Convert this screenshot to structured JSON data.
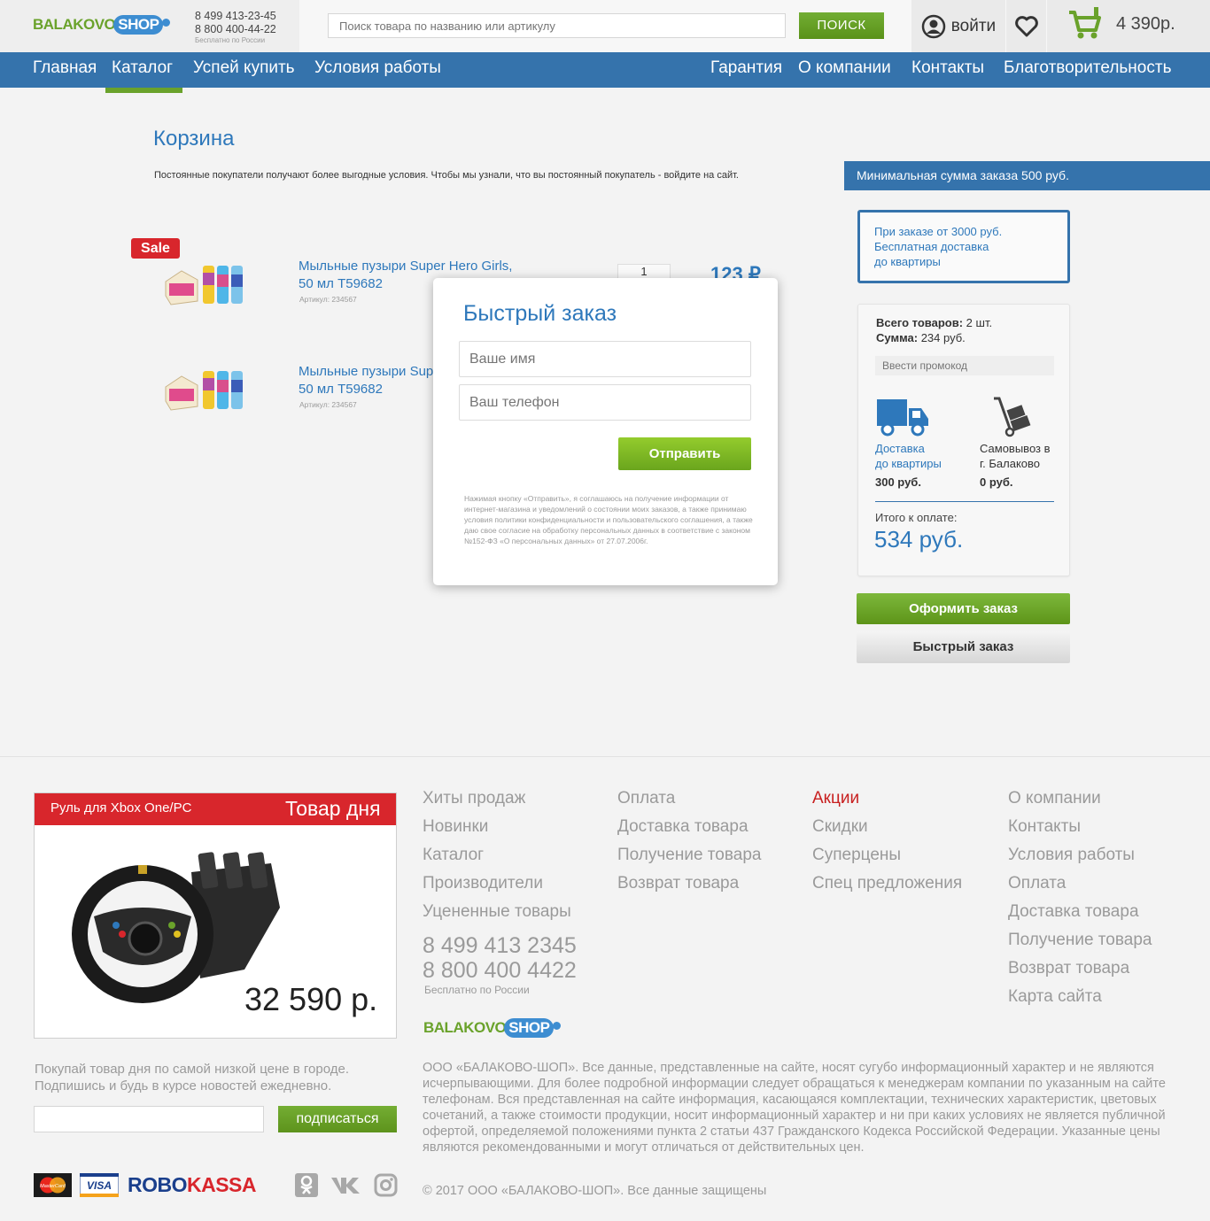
{
  "header": {
    "logo": {
      "part1": "BALAKOVO",
      "part2": "SHOP"
    },
    "phone1": "8 499 413-23-45",
    "phone2": "8 800 400-44-22",
    "phone_note": "Бесплатно по России",
    "search_placeholder": "Поиск товара по названию или артикулу",
    "search_button": "ПОИСК",
    "login": "войти",
    "cart_total": "4 390р."
  },
  "nav": {
    "left": [
      "Главная",
      "Каталог",
      "Успей купить",
      "Условия работы"
    ],
    "right": [
      "Гарантия",
      "О компании",
      "Контакты",
      "Благотворительность"
    ],
    "active": "Каталог"
  },
  "cart": {
    "title": "Корзина",
    "notice": "Постоянные покупатели получают более выгодные условия. Чтобы мы узнали, что вы постоянный покупатель - войдите на сайт.",
    "min_sum": "Минимальная сумма заказа 500 руб.",
    "items": [
      {
        "badge": "Sale",
        "name_l1": "Мыльные пузыри Super Hero Girls,",
        "name_l2": "50 мл T59682",
        "sku": "Артикул: 234567",
        "qty": "1",
        "price": "123 ₽"
      },
      {
        "name_l1": "Мыльные пузыри Super Hero Girls,",
        "name_l2": "50 мл T59682",
        "sku": "Артикул: 234567"
      }
    ],
    "free_shipping": {
      "l1": "При заказе от 3000 руб.",
      "l2": "Бесплатная доставка",
      "l3": "до квартиры"
    },
    "summary": {
      "items_label": "Всего товаров:",
      "items_value": "2 шт.",
      "sum_label": "Сумма:",
      "sum_value": "234 руб.",
      "promo_placeholder": "Ввести промокод",
      "delivery": {
        "l1": "Доставка",
        "l2": "до квартиры",
        "price": "300 руб."
      },
      "pickup": {
        "l1": "Самовывоз в",
        "l2": "г. Балаково",
        "price": "0 руб."
      },
      "total_label": "Итого к оплате:",
      "total_value": "534 руб."
    },
    "order_button": "Оформить заказ",
    "quick_button": "Быстрый заказ"
  },
  "modal": {
    "title": "Быстрый заказ",
    "name_placeholder": "Ваше имя",
    "phone_placeholder": "Ваш телефон",
    "submit": "Отправить",
    "legal": "Нажимая кнопку «Отправить», я соглашаюсь на получение информации от интернет-магазина и уведомлений о состоянии моих заказов, а также принимаю условия политики конфиденциальности и пользовательского соглашения, а также даю свое согласие на обработку персональных данных в соответствие с законом №152-ФЗ «О персональных данных» от 27.07.2006г."
  },
  "footer": {
    "deal": {
      "name": "Руль для Xbox One/PC",
      "tag": "Товар дня",
      "price": "32 590 р."
    },
    "subscribe_text": "Покупай товар дня по самой низкой цене в городе. Подпишись и будь в курсе новостей ежедневно.",
    "subscribe_button": "подписаться",
    "col1": [
      "Хиты продаж",
      "Новинки",
      "Каталог",
      "Производители",
      "Уцененные товары"
    ],
    "col2": [
      "Оплата",
      "Доставка товара",
      "Получение товара",
      "Возврат товара"
    ],
    "col3": [
      "Акции",
      "Скидки",
      "Суперцены",
      "Спец предложения"
    ],
    "col4": [
      "О компании",
      "Контакты",
      "Условия работы",
      "Оплата",
      "Доставка товара",
      "Получение товара",
      "Возврат товара",
      "Карта сайта"
    ],
    "phone1": "8 499 413 2345",
    "phone2": "8 800 400 4422",
    "phone_note": "Бесплатно по России",
    "legal": "ООО «БАЛАКОВО-ШОП». Все данные, представленные на сайте, носят сугубо информационный характер и не являются исчерпывающими. Для более подробной информации следует обращаться к менеджерам компании по указанным на сайте телефонам. Вся представленная на сайте информация, касающаяся комплектации, технических характеристик, цветовых сочетаний, а также стоимости продукции, носит информационный характер и ни при каких условиях не является публичной офертой, определяемой положениями пункта 2 статьи 437 Гражданского Кодекса Российской Федерации. Указанные цены являются рекомендованными и могут отличаться от действительных цен.",
    "copyright": "© 2017 ООО «БАЛАКОВО-ШОП». Все данные защищены",
    "payments": {
      "mastercard": "MasterCard",
      "visa": "VISA",
      "robo": "ROBO",
      "kassa": "KASSA"
    }
  },
  "colors": {
    "brand_blue": "#3573ac",
    "brand_green": "#6aa22b",
    "sale_red": "#d8262c",
    "link_blue": "#2e78bb"
  }
}
